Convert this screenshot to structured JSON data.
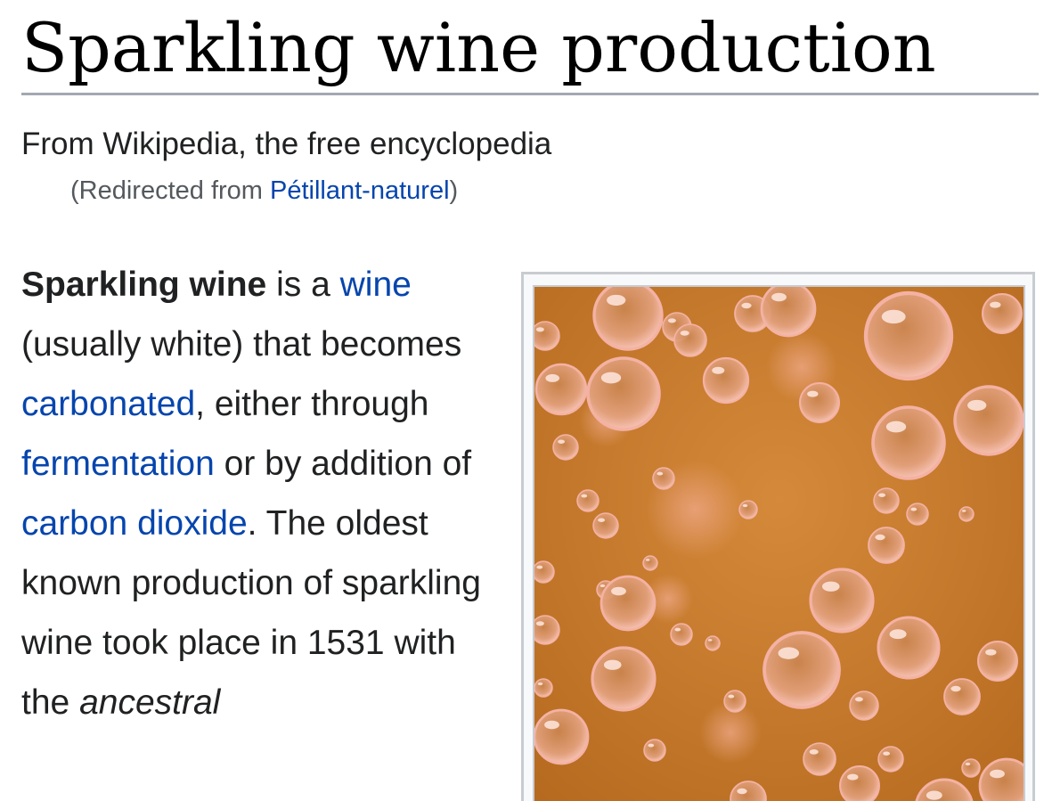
{
  "article": {
    "title": "Sparkling wine production",
    "tagline": "From Wikipedia, the free encyclopedia",
    "redirect": {
      "prefix": "(Redirected from ",
      "link": "Pétillant-naturel",
      "suffix": ")"
    }
  },
  "lede": {
    "s1_bold": "Sparkling wine",
    "s2": " is a ",
    "link_wine": "wine",
    "s3": " (usually white) that becomes ",
    "link_carbonated": "carbonated",
    "s4": ", either through ",
    "link_fermentation": "fermentation",
    "s5": " or by addition of ",
    "link_co2": "carbon dioxide",
    "s6": ". The oldest known production of sparkling wine took place in 1531 with the ",
    "s7_italic": "ancestral"
  },
  "image": {
    "icon": "bubbles-photo",
    "colors": {
      "background": "#c77a2a",
      "bubble_rim": "#f4b2a4",
      "bubble_fill": "#d98f6a"
    }
  },
  "colors": {
    "link": "#0645ad",
    "text": "#202122",
    "rule": "#a2a9b1"
  }
}
